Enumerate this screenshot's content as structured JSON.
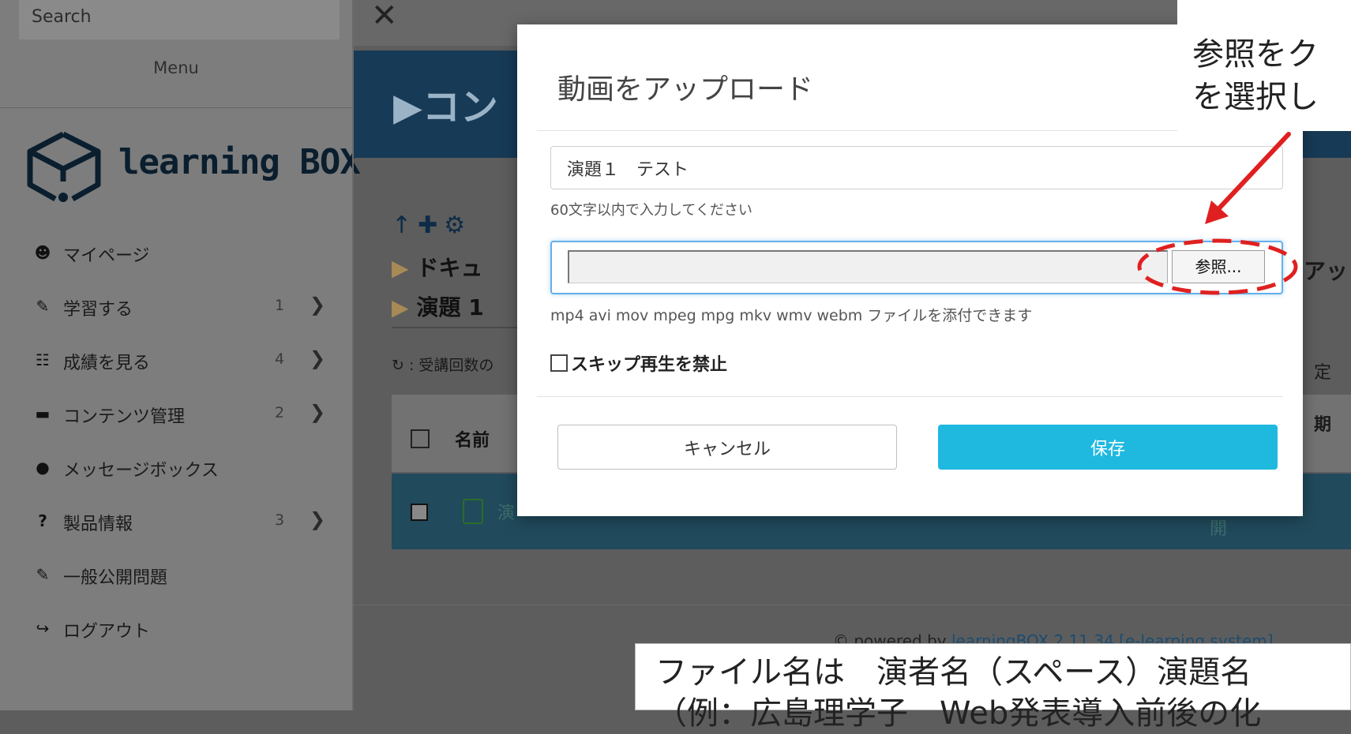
{
  "sidebar": {
    "search_placeholder": "Search",
    "menu_title": "Menu",
    "logo_text": "learning BOX",
    "items": [
      {
        "icon": "user-icon",
        "glyph": "☻",
        "label": "マイページ",
        "count": "",
        "chevron": ""
      },
      {
        "icon": "pencil-icon",
        "glyph": "✎",
        "label": "学習する",
        "count": "1",
        "chevron": "❯"
      },
      {
        "icon": "chart-icon",
        "glyph": "☷",
        "label": "成績を見る",
        "count": "4",
        "chevron": "❯"
      },
      {
        "icon": "folder-icon",
        "glyph": "▬",
        "label": "コンテンツ管理",
        "count": "2",
        "chevron": "❯"
      },
      {
        "icon": "comments-icon",
        "glyph": "●",
        "label": "メッセージボックス",
        "count": "",
        "chevron": ""
      },
      {
        "icon": "question-icon",
        "glyph": "?",
        "label": "製品情報",
        "count": "3",
        "chevron": "❯"
      },
      {
        "icon": "pencil-icon",
        "glyph": "✎",
        "label": "一般公開問題",
        "count": "",
        "chevron": ""
      },
      {
        "icon": "logout-icon",
        "glyph": "↪",
        "label": "ログアウト",
        "count": "",
        "chevron": ""
      }
    ]
  },
  "main": {
    "close_glyph": "✕",
    "header_title": "▶コン",
    "tool_icons": "↑✚⚙",
    "breadcrumbs": [
      "ドキュ",
      "演題 1"
    ],
    "repeat_text": "↻ : 受講回数の",
    "table": {
      "name_header": "名前",
      "row_label": "演"
    },
    "right_fragments": {
      "upload": "アッ",
      "settings": "定",
      "period": "期",
      "open": "開"
    },
    "footer": {
      "prefix": "© powered by ",
      "link": "learningBOX 2.11.34 [e-learning system]"
    }
  },
  "modal": {
    "title": "動画をアップロード",
    "title_input_value": "演題１　テスト",
    "title_hint": "60文字以内で入力してください",
    "file_path_value": "",
    "browse_label": "参照...",
    "file_hint": "mp4 avi mov mpeg mpg mkv wmv webm ファイルを添付できます",
    "skip_label": "スキップ再生を禁止",
    "cancel_label": "キャンセル",
    "save_label": "保存"
  },
  "annotations": {
    "top_line1": "参照をク",
    "top_line2": "を選択し",
    "bottom_line1": "ファイル名は　演者名（スペース）演題名",
    "bottom_line2": "（例：広島理学子　Web発表導入前後の化",
    "accent_color": "#e02020"
  },
  "colors": {
    "primary": "#1fb9e0",
    "focus": "#66afe9",
    "header_blue": "#173a56"
  }
}
